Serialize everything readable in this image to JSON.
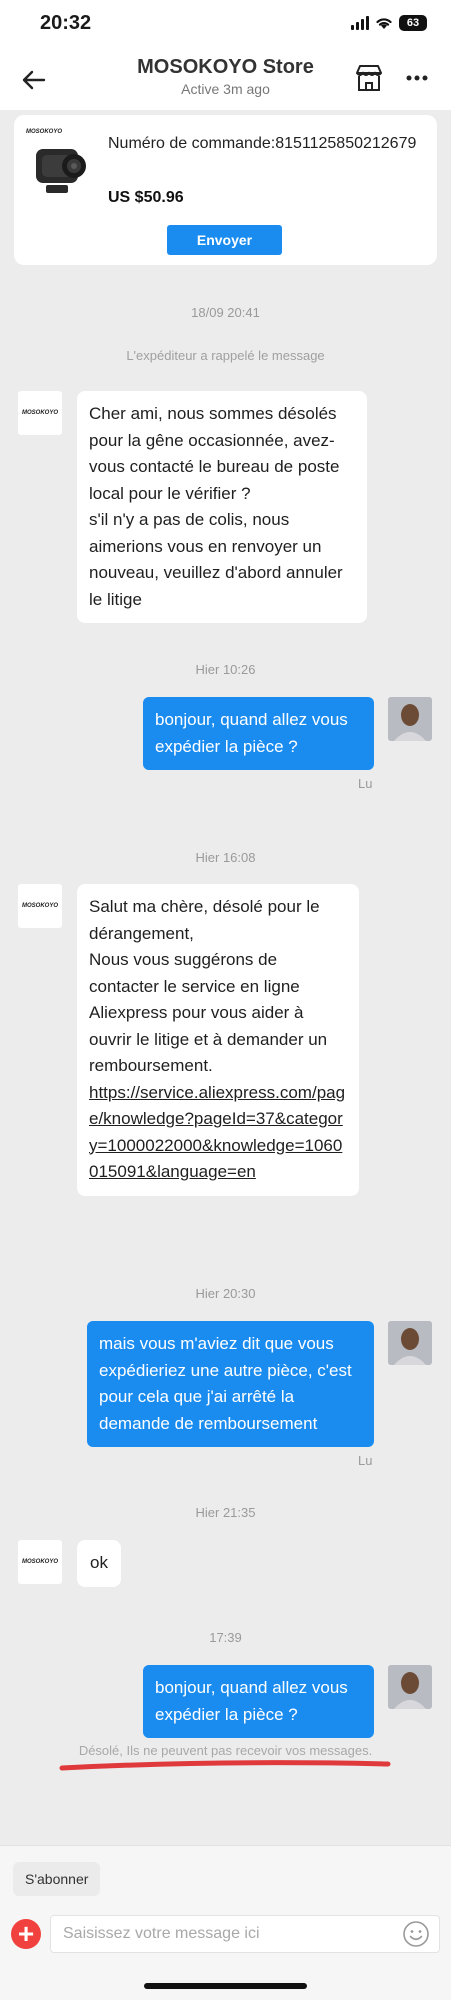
{
  "status_bar": {
    "time": "20:32",
    "battery": "63"
  },
  "header": {
    "title": "MOSOKOYO Store",
    "subtitle": "Active 3m ago"
  },
  "product": {
    "brand": "MOSOKOYO",
    "order_label": "Numéro de commande:8151125850212679",
    "price": "US $50.96",
    "send_label": "Envoyer"
  },
  "messages": [
    {
      "type": "timestamp",
      "text": "18/09 20:41"
    },
    {
      "type": "system",
      "text": "L'expéditeur a rappelé le message"
    },
    {
      "type": "incoming",
      "lines": [
        "Cher ami, nous sommes désolés",
        "pour la gêne occasionnée, avez-",
        "vous contacté le bureau de poste",
        "local pour le vérifier ?",
        "s'il n'y a pas de colis, nous",
        "aimerions vous en renvoyer un",
        "nouveau, veuillez d'abord annuler",
        "le litige"
      ]
    },
    {
      "type": "timestamp",
      "text": "Hier 10:26"
    },
    {
      "type": "outgoing",
      "lines": [
        "bonjour, quand allez vous",
        "expédier la pièce ?"
      ],
      "status": "Lu"
    },
    {
      "type": "timestamp",
      "text": "Hier 16:08"
    },
    {
      "type": "incoming",
      "lines": [
        "Salut ma chère, désolé pour le",
        "dérangement,",
        "Nous vous suggérons de",
        "contacter le service en ligne",
        "Aliexpress pour vous aider à",
        "ouvrir le litige et à demander un",
        "remboursement."
      ],
      "link": "https://service.aliexpress.com/page/knowledge?pageId=37&category=1000022000&knowledge=1060015091&language=en"
    },
    {
      "type": "timestamp",
      "text": "Hier 20:30"
    },
    {
      "type": "outgoing",
      "lines": [
        "mais vous m'aviez dit que vous",
        "expédieriez une autre pièce, c'est",
        "pour cela que j'ai arrêté la",
        "demande de remboursement"
      ],
      "status": "Lu"
    },
    {
      "type": "timestamp",
      "text": "Hier 21:35"
    },
    {
      "type": "incoming",
      "lines": [
        "ok"
      ]
    },
    {
      "type": "timestamp",
      "text": "17:39"
    },
    {
      "type": "outgoing",
      "lines": [
        "bonjour, quand allez vous",
        "expédier la pièce ?"
      ]
    }
  ],
  "failed_notice": "Désolé, Ils ne peuvent pas recevoir vos messages.",
  "footer": {
    "subscribe_label": "S'abonner",
    "input_placeholder": "Saisissez votre message ici"
  },
  "colors": {
    "accent": "#1a8cf0",
    "underline": "#e0393c",
    "add_button": "#f0413e"
  },
  "icons": [
    "back-arrow-icon",
    "store-icon",
    "more-icon",
    "plus-icon",
    "emoji-icon"
  ]
}
